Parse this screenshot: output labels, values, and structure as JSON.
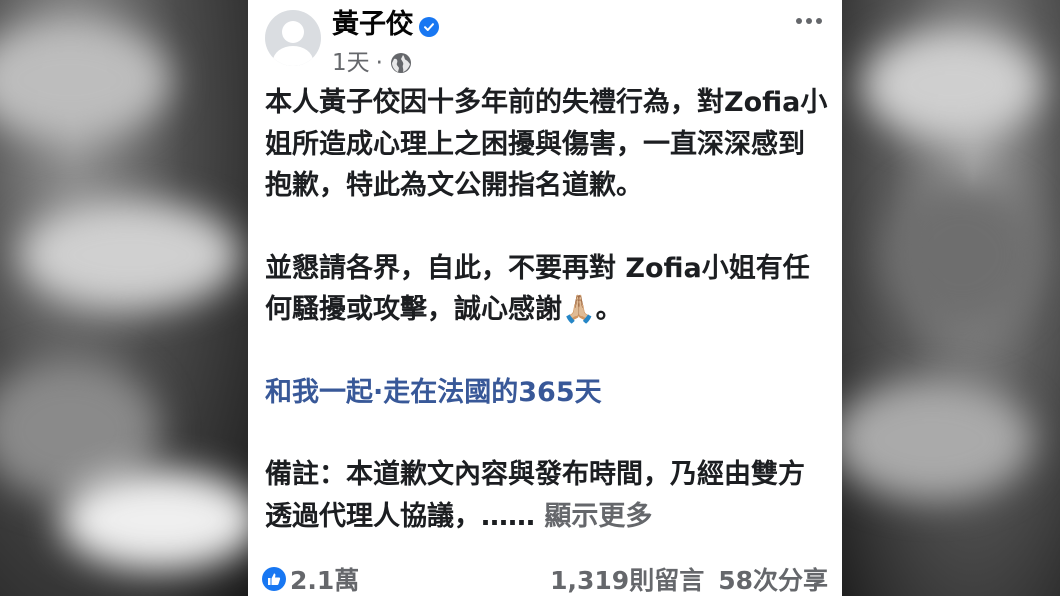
{
  "post": {
    "author": "黃子佼",
    "time": "1天",
    "separator": "·",
    "paragraphs": [
      "本人黃子佼因十多年前的失禮行為，對Zofia小姐所造成心理上之困擾與傷害，一直深深感到抱歉，特此為文公開指名道歉。",
      "並懇請各界，自此，不要再對 Zofia小姐有任何騷擾或攻擊，誠心感謝🙏🏼。"
    ],
    "hashtag": "和我一起·走在法國的365天",
    "note": "備註：本道歉文內容與發布時間，乃經由雙方透過代理人協議，……",
    "see_more": "顯示更多"
  },
  "stats": {
    "likes": "2.1萬",
    "comments": "1,319則留言",
    "shares": "58次分享"
  },
  "colors": {
    "link": "#385898",
    "verified": "#1877f2",
    "muted": "#65676b"
  }
}
